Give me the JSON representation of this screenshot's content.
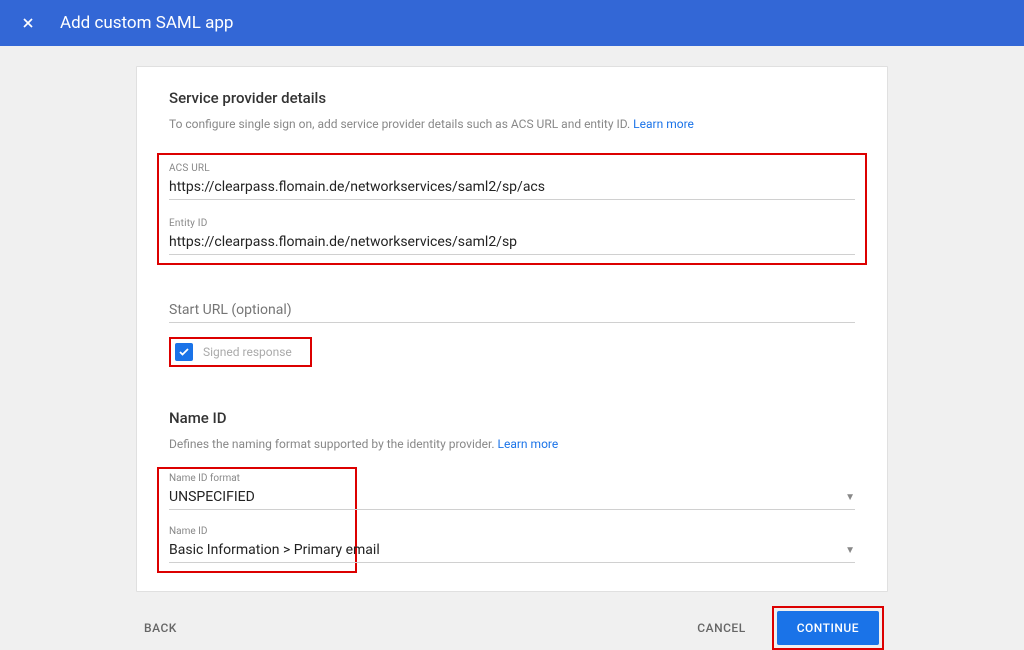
{
  "header": {
    "title": "Add custom SAML app"
  },
  "sp": {
    "title": "Service provider details",
    "desc": "To configure single sign on, add service provider details such as ACS URL and entity ID. ",
    "learn": "Learn more",
    "acs_label": "ACS URL",
    "acs_value": "https://clearpass.flomain.de/networkservices/saml2/sp/acs",
    "entity_label": "Entity ID",
    "entity_value": "https://clearpass.flomain.de/networkservices/saml2/sp",
    "start_url_placeholder": "Start URL (optional)",
    "signed_label": "Signed response",
    "signed_checked": true
  },
  "nameid": {
    "title": "Name ID",
    "desc": "Defines the naming format supported by the identity provider. ",
    "learn": "Learn more",
    "format_label": "Name ID format",
    "format_value": "UNSPECIFIED",
    "name_label": "Name ID",
    "name_value": "Basic Information > Primary email"
  },
  "footer": {
    "back": "BACK",
    "cancel": "CANCEL",
    "continue": "CONTINUE"
  }
}
